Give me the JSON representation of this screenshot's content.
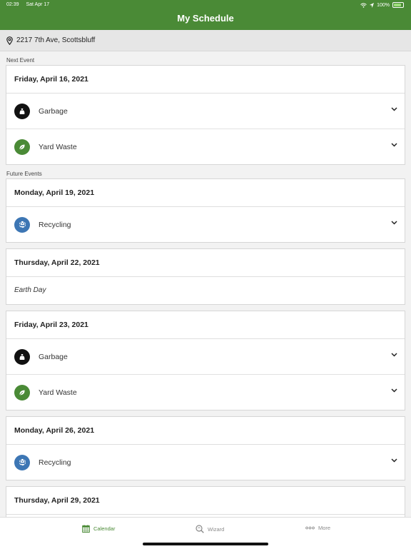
{
  "status": {
    "time": "02:39",
    "date": "Sat Apr 17",
    "battery": "100%"
  },
  "header": {
    "title": "My Schedule"
  },
  "address": "2217 7th Ave, Scottsbluff",
  "sections": {
    "next": "Next Event",
    "future": "Future Events"
  },
  "colors": {
    "brand": "#4a8a36",
    "garbage": "#111111",
    "yard": "#4a8a36",
    "recycling": "#3d76b4"
  },
  "events": [
    {
      "date": "Friday, April 16, 2021",
      "items": [
        {
          "label": "Garbage",
          "icon": "garbage-bag-icon"
        },
        {
          "label": "Yard Waste",
          "icon": "leaf-icon"
        }
      ]
    },
    {
      "date": "Monday, April 19, 2021",
      "items": [
        {
          "label": "Recycling",
          "icon": "recycle-icon"
        }
      ]
    },
    {
      "date": "Thursday, April 22, 2021",
      "note": "Earth Day"
    },
    {
      "date": "Friday, April 23, 2021",
      "items": [
        {
          "label": "Garbage",
          "icon": "garbage-bag-icon"
        },
        {
          "label": "Yard Waste",
          "icon": "leaf-icon"
        }
      ]
    },
    {
      "date": "Monday, April 26, 2021",
      "items": [
        {
          "label": "Recycling",
          "icon": "recycle-icon"
        }
      ]
    },
    {
      "date": "Thursday, April 29, 2021"
    }
  ],
  "tabs": [
    {
      "label": "Calendar",
      "icon": "calendar-icon",
      "active": true
    },
    {
      "label": "Wizard",
      "icon": "search-wizard-icon"
    },
    {
      "label": "More",
      "icon": "more-icon"
    }
  ]
}
